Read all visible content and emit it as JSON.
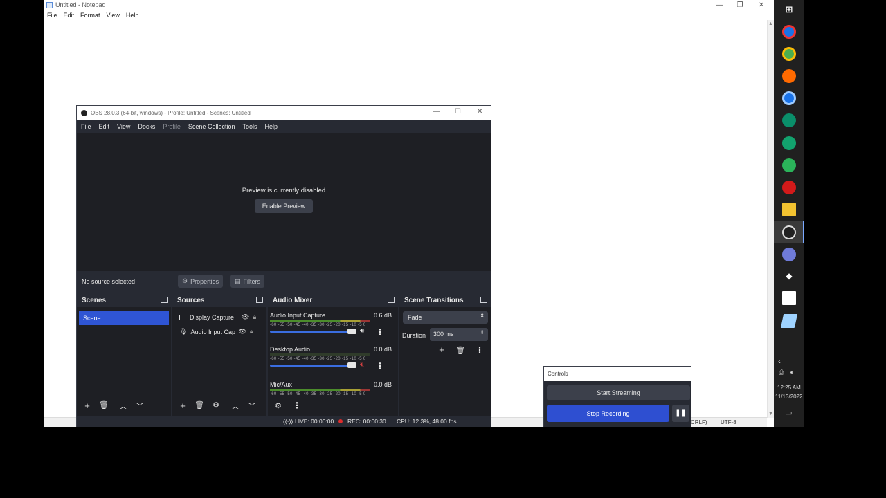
{
  "notepad": {
    "title": "Untitled - Notepad",
    "menu": [
      "File",
      "Edit",
      "Format",
      "View",
      "Help"
    ],
    "status": {
      "line_ending": "CRLF)",
      "encoding": "UTF-8"
    }
  },
  "obs": {
    "title": "OBS 28.0.3 (64-bit, windows) - Profile: Untitled - Scenes: Untitled",
    "menu": [
      "File",
      "Edit",
      "View",
      "Docks",
      "Profile",
      "Scene Collection",
      "Tools",
      "Help"
    ],
    "preview_disabled_text": "Preview is currently disabled",
    "enable_preview_label": "Enable Preview",
    "no_source_text": "No source selected",
    "properties_label": "Properties",
    "filters_label": "Filters",
    "scenes": {
      "title": "Scenes",
      "items": [
        "Scene"
      ]
    },
    "sources": {
      "title": "Sources",
      "items": [
        {
          "label": "Display Capture",
          "icon": "monitor-icon"
        },
        {
          "label": "Audio Input Cap",
          "icon": "microphone-icon"
        }
      ]
    },
    "audio_mixer": {
      "title": "Audio Mixer",
      "scale": "-60 -55 -50 -45 -40 -35 -30 -25 -20 -15 -10 -5 0",
      "channels": [
        {
          "name": "Audio Input Capture",
          "db": "0.6 dB",
          "muted": false
        },
        {
          "name": "Desktop Audio",
          "db": "0.0 dB",
          "muted": true
        },
        {
          "name": "Mic/Aux",
          "db": "0.0 dB",
          "muted": false
        }
      ]
    },
    "transitions": {
      "title": "Scene Transitions",
      "selected": "Fade",
      "duration_label": "Duration",
      "duration_value": "300 ms"
    },
    "status": {
      "live": "LIVE: 00:00:00",
      "rec": "REC: 00:00:30",
      "cpu": "CPU: 12.3%, 48.00 fps"
    }
  },
  "controls": {
    "title": "Controls",
    "start_streaming": "Start Streaming",
    "stop_recording": "Stop Recording"
  },
  "taskbar": {
    "time": "12:25 AM",
    "date": "11/13/2022"
  },
  "colors": {
    "accent": "#2e4fd1",
    "scene_selected": "#2f55d4",
    "panel": "#272a33",
    "dock_bg": "#1e1f24"
  }
}
